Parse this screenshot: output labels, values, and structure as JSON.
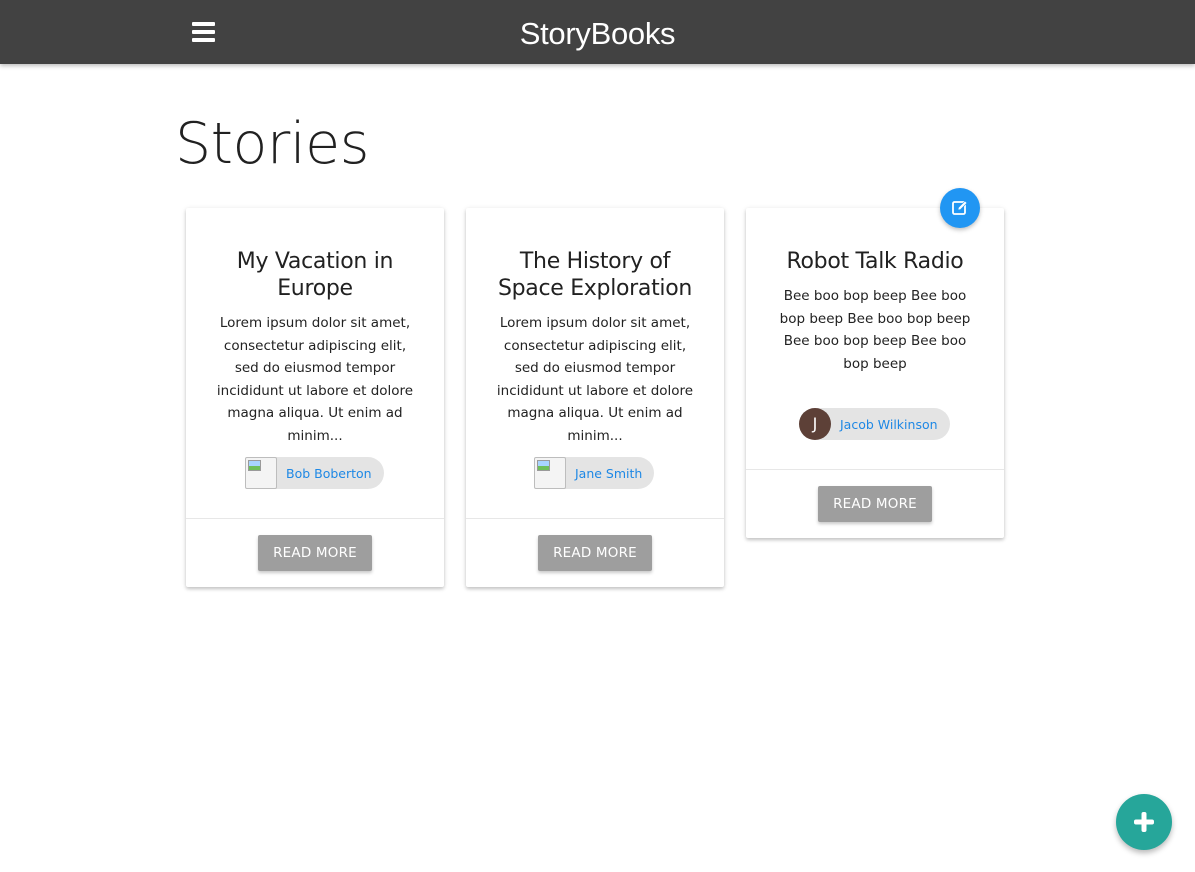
{
  "navbar": {
    "brand": "StoryBooks",
    "menu_icon": "hamburger-menu-icon",
    "background": "#424242"
  },
  "page": {
    "title": "Stories"
  },
  "stories": [
    {
      "title": "My Vacation in Europe",
      "body": "Lorem ipsum dolor sit amet, consectetur adipiscing elit, sed do eiusmod tempor incididunt ut labore et dolore magna aliqua. Ut enim ad minim...",
      "author": "Bob Boberton",
      "author_avatar": "broken-image-icon",
      "action_label": "READ MORE"
    },
    {
      "title": "The History of Space Exploration",
      "body": "Lorem ipsum dolor sit amet, consectetur adipiscing elit, sed do eiusmod tempor incididunt ut labore et dolore magna aliqua. Ut enim ad minim...",
      "author": "Jane Smith",
      "author_avatar": "broken-image-icon",
      "action_label": "READ MORE"
    },
    {
      "title": "Robot Talk Radio",
      "body": "Bee boo bop beep Bee boo bop beep Bee boo bop beep Bee boo bop beep Bee boo bop beep",
      "author": "Jacob Wilkinson",
      "author_initial": "J",
      "action_label": "READ MORE",
      "editable": true
    }
  ],
  "icons": {
    "edit": "edit-icon",
    "add": "add-icon"
  },
  "colors": {
    "navbar": "#424242",
    "chip_link": "#1e88e5",
    "button": "#9e9e9e",
    "edit_fab": "#2196f3",
    "add_fab": "#26a69a",
    "avatar": "#5d4037"
  }
}
